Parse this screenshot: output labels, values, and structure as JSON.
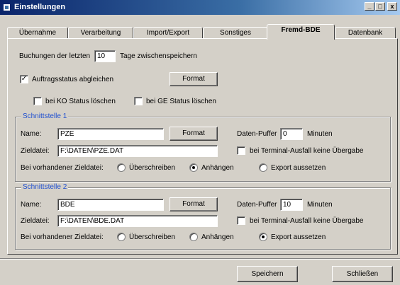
{
  "window": {
    "title": "Einstellungen",
    "controls": {
      "minimize": "_",
      "maximize": "□",
      "close": "x"
    }
  },
  "tabs": [
    {
      "label": "Übernahme"
    },
    {
      "label": "Verarbeitung"
    },
    {
      "label": "Import/Export"
    },
    {
      "label": "Sonstiges"
    },
    {
      "label": "Fremd-BDE"
    },
    {
      "label": "Datenbank"
    }
  ],
  "active_tab": "Fremd-BDE",
  "general": {
    "buchungen_prefix": "Buchungen der letzten",
    "buchungen_value": "10",
    "buchungen_suffix": "Tage zwischenspeichern",
    "auftragsstatus_label": "Auftragsstatus abgleichen",
    "auftragsstatus_checked": true,
    "format_label": "Format",
    "ko_label": "bei KO Status löschen",
    "ko_checked": false,
    "ge_label": "bei GE Status löschen",
    "ge_checked": false
  },
  "schnittstelle1": {
    "title": "Schnittstelle 1",
    "name_label": "Name:",
    "name_value": "PZE",
    "format_label": "Format",
    "puffer_label": "Daten-Puffer",
    "puffer_value": "0",
    "puffer_unit": "Minuten",
    "zieldatei_label": "Zieldatei:",
    "zieldatei_value": "F:\\DATEN\\PZE.DAT",
    "ausfall_label": "bei Terminal-Ausfall keine Übergabe",
    "ausfall_checked": false,
    "vorhanden_label": "Bei vorhandener Zieldatei:",
    "options": [
      "Überschreiben",
      "Anhängen",
      "Export aussetzen"
    ],
    "selected": "Anhängen"
  },
  "schnittstelle2": {
    "title": "Schnittstelle 2",
    "name_label": "Name:",
    "name_value": "BDE",
    "format_label": "Format",
    "puffer_label": "Daten-Puffer",
    "puffer_value": "10",
    "puffer_unit": "Minuten",
    "zieldatei_label": "Zieldatei:",
    "zieldatei_value": "F:\\DATEN\\BDE.DAT",
    "ausfall_label": "bei Terminal-Ausfall keine Übergabe",
    "ausfall_checked": false,
    "vorhanden_label": "Bei vorhandener Zieldatei:",
    "options": [
      "Überschreiben",
      "Anhängen",
      "Export aussetzen"
    ],
    "selected": "Export aussetzen"
  },
  "footer": {
    "save_label": "Speichern",
    "close_label": "Schließen"
  },
  "colors": {
    "group_title": "#1f4fd0",
    "face": "#d4d0c8",
    "titlebar": "#0a246a"
  }
}
